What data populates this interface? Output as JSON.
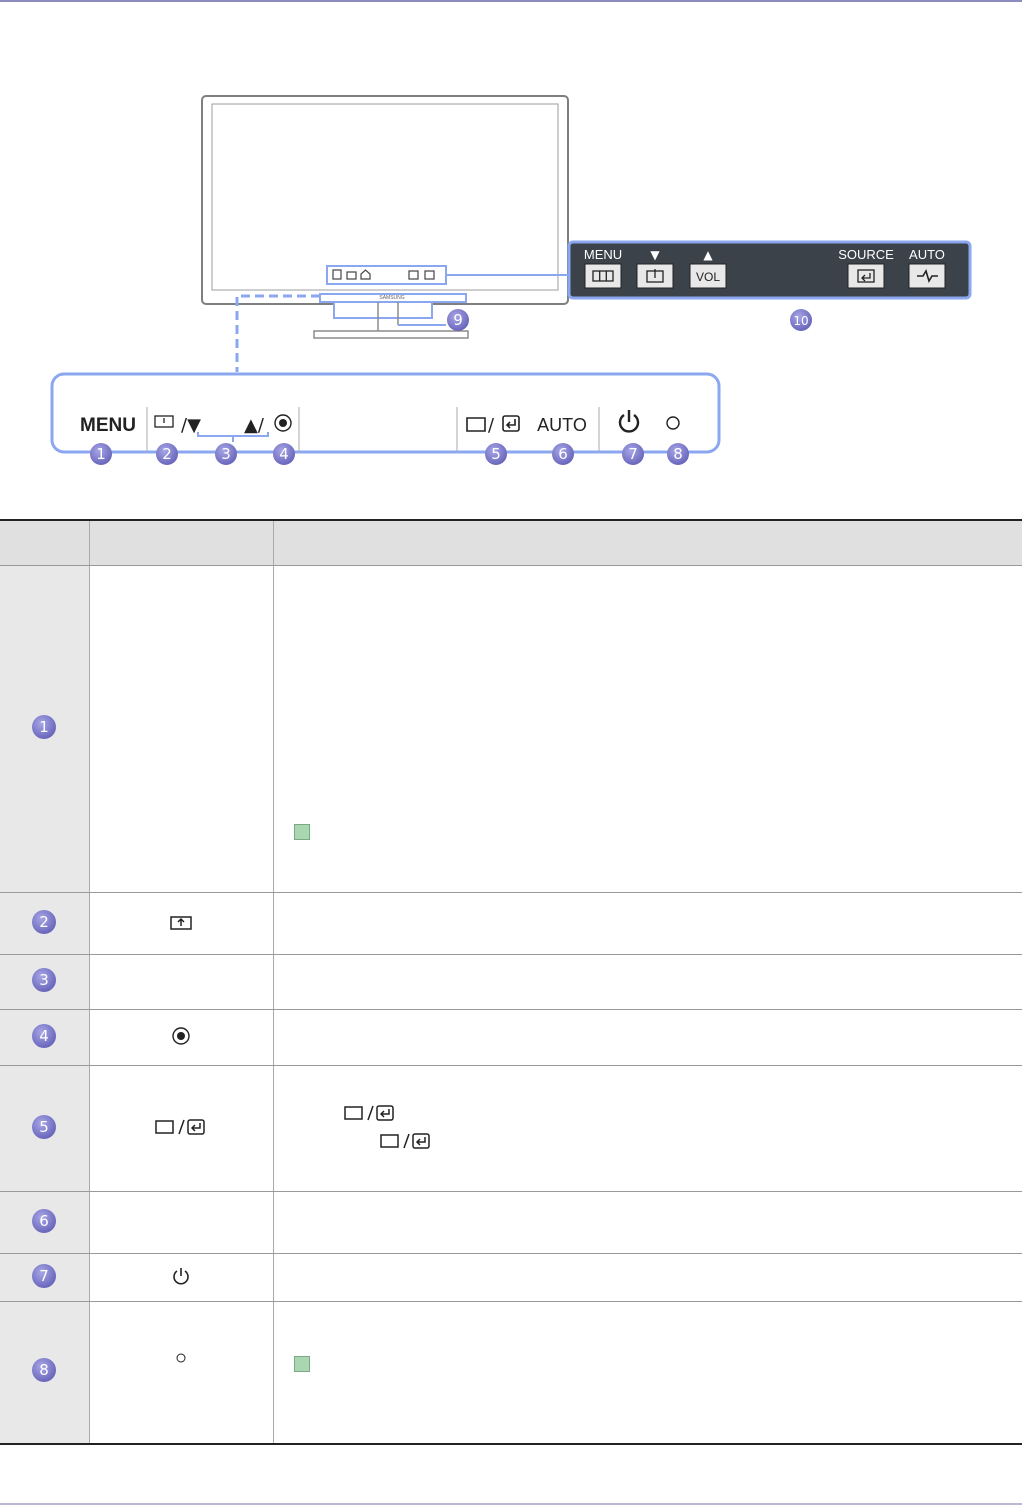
{
  "diagram": {
    "brand": "SAMSUNG",
    "panel_labels": [
      "MENU",
      "▼",
      "▲",
      "SOURCE",
      "AUTO"
    ],
    "panel_vol_label": "VOL",
    "strip_labels": {
      "menu": "MENU",
      "auto": "AUTO"
    },
    "callouts": [
      "1",
      "2",
      "3",
      "4",
      "5",
      "6",
      "7",
      "8",
      "9",
      "10"
    ]
  },
  "table": {
    "headers": [
      "",
      "",
      ""
    ],
    "rows": [
      {
        "number": "1"
      },
      {
        "number": "2"
      },
      {
        "number": "3"
      },
      {
        "number": "4"
      },
      {
        "number": "5"
      },
      {
        "number": "6"
      },
      {
        "number": "7"
      },
      {
        "number": "8"
      }
    ]
  },
  "icons": [
    "note-icon",
    "source-enter-icon",
    "power-icon",
    "circle-icon",
    "enter-icon",
    "menu-icon",
    "brightness-icon"
  ],
  "colors": {
    "callout": "#7b79c8",
    "panel_outline": "#8aa7ef",
    "panel_dark": "#3c4249"
  }
}
